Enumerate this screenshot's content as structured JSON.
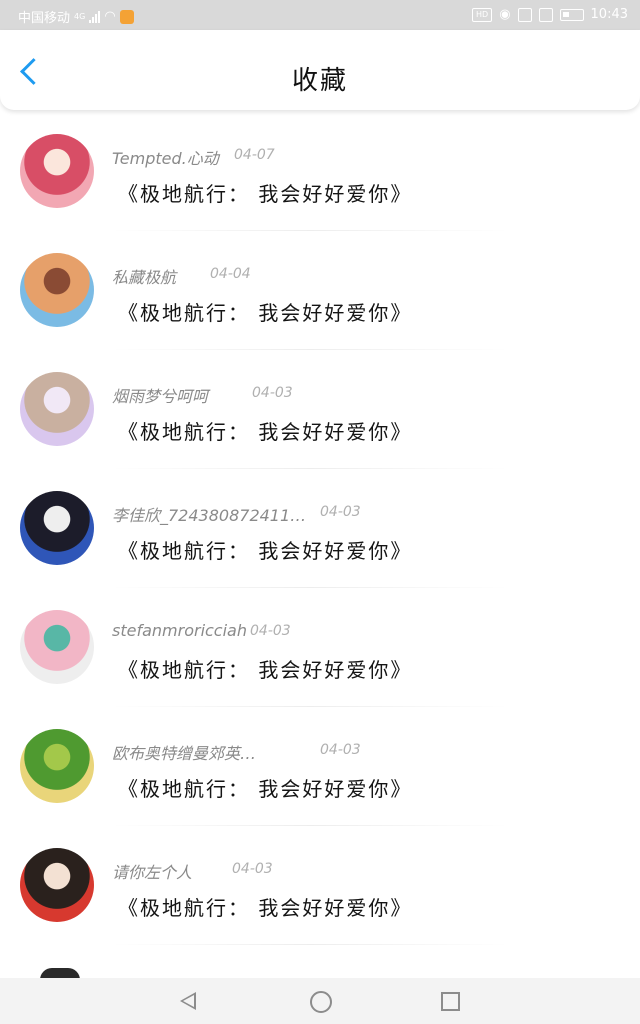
{
  "status_bar": {
    "carrier": "中国移动",
    "network": "4G",
    "time": "10:43",
    "hd_label": "HD"
  },
  "header": {
    "title": "收藏"
  },
  "favorites": [
    {
      "user": "Tempted.心动",
      "date": "04-07",
      "song": "《极地航行： 我会好好爱你》",
      "avatar_colors": [
        "#f2a7b3",
        "#d84e66",
        "#fbe6dc"
      ]
    },
    {
      "user": "私藏极航",
      "date": "04-04",
      "song": "《极地航行： 我会好好爱你》",
      "avatar_colors": [
        "#7bbbe4",
        "#e6a06a",
        "#8a4b34"
      ]
    },
    {
      "user": "烟雨梦兮呵呵",
      "date": "04-03",
      "song": "《极地航行： 我会好好爱你》",
      "avatar_colors": [
        "#d9c7ee",
        "#c9b0a0",
        "#f1e8f6"
      ]
    },
    {
      "user": "李佳欣_724380872411…",
      "date": "04-03",
      "song": "《极地航行： 我会好好爱你》",
      "avatar_colors": [
        "#2f56b8",
        "#1c1c2a",
        "#eeeeee"
      ]
    },
    {
      "user": "stefanmroricciah",
      "date": "04-03",
      "song": "《极地航行： 我会好好爱你》",
      "avatar_colors": [
        "#eeeeee",
        "#f2b6c6",
        "#58b7a6"
      ]
    },
    {
      "user": "欧布奥特缯曼郊英…",
      "date": "04-03",
      "song": "《极地航行： 我会好好爱你》",
      "avatar_colors": [
        "#e9d57a",
        "#4f9a30",
        "#a3c84a"
      ]
    },
    {
      "user": "请你左个人",
      "date": "04-03",
      "song": "《极地航行： 我会好好爱你》",
      "avatar_colors": [
        "#d7392f",
        "#2a211d",
        "#f3e1d3"
      ]
    }
  ],
  "nav_bar": {
    "back_icon": "back-triangle-icon",
    "home_icon": "home-circle-icon",
    "recent_icon": "recent-square-icon"
  }
}
